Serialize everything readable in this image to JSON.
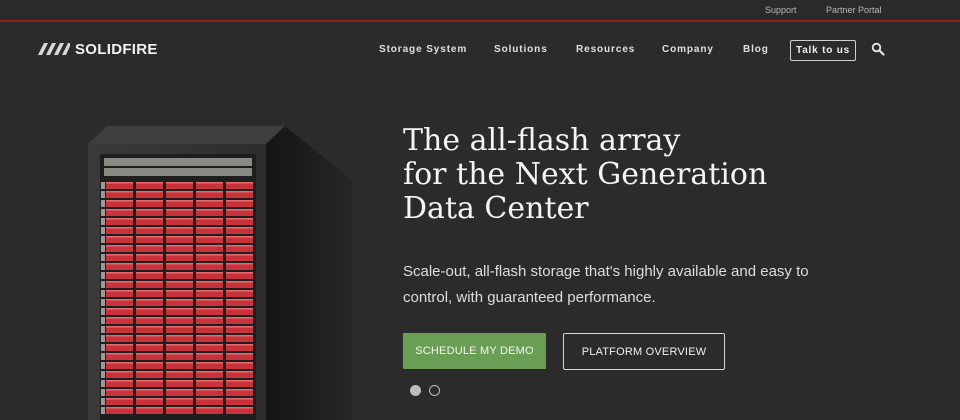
{
  "utility_bar": {
    "support": "Support",
    "partner_portal": "Partner Portal"
  },
  "brand": {
    "name": "SOLIDFIRE"
  },
  "nav": {
    "items": [
      {
        "label": "Storage System"
      },
      {
        "label": "Solutions"
      },
      {
        "label": "Resources"
      },
      {
        "label": "Company"
      },
      {
        "label": "Blog"
      }
    ],
    "talk_label": "Talk to us",
    "search_icon": "search-icon"
  },
  "hero": {
    "title_lines": [
      "The all-flash array",
      "for the Next Generation",
      "Data Center"
    ],
    "subtitle": "Scale-out, all-flash storage that's highly available and easy to control, with guaranteed performance.",
    "cta_primary": "SCHEDULE MY DEMO",
    "cta_secondary": "PLATFORM OVERVIEW",
    "carousel": {
      "slides": 2,
      "active": 1
    }
  },
  "colors": {
    "background": "#2b2b2b",
    "accent_line": "#8b1d1d",
    "cta_green": "#6a9e55",
    "drive_red": "#c8333b"
  }
}
